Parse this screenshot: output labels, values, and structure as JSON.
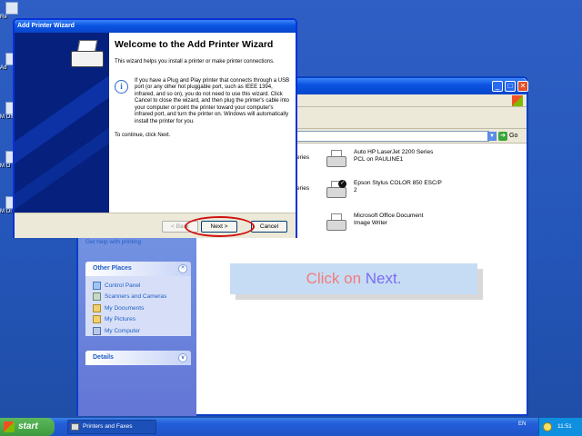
{
  "desktop": {
    "icons": [
      {
        "label": "Re",
        "icon": "recycle-bin-icon"
      },
      {
        "label": "Ad",
        "icon": "desktop-shortcut-icon"
      },
      {
        "label": "M Off",
        "icon": "desktop-shortcut-icon"
      },
      {
        "label": "M O",
        "icon": "desktop-shortcut-icon"
      },
      {
        "label": "M Ol",
        "icon": "desktop-shortcut-icon"
      }
    ]
  },
  "wizard": {
    "title": "Add Printer Wizard",
    "heading": "Welcome to the Add Printer Wizard",
    "intro": "This wizard helps you install a printer or make printer connections.",
    "info": "If you have a Plug and Play printer that connects through a USB port (or any other hot pluggable port, such as IEEE 1394, infrared, and so on), you do not need to use this wizard. Click Cancel to close the wizard, and then plug the printer's cable into your computer or point the printer toward your computer's infrared port, and turn the printer on. Windows will automatically install the printer for you.",
    "continue": "To continue, click Next.",
    "back_label": "< Back",
    "next_label": "Next >",
    "cancel_label": "Cancel"
  },
  "explorer": {
    "go_label": "Go",
    "printers": [
      {
        "name": "Auto HP LaserJet 2200 Series PCL on PAULINE1",
        "left_fragment": "eries",
        "default": false
      },
      {
        "name": "Epson Stylus COLOR 850 ESC/P 2",
        "left_fragment": "eries",
        "default": true
      },
      {
        "name": "Microsoft Office Document Image Writer",
        "left_fragment": "",
        "default": false
      }
    ],
    "help_link": "Get help with printing",
    "other_places": {
      "title": "Other Places",
      "links": [
        "Control Panel",
        "Scanners and Cameras",
        "My Documents",
        "My Pictures",
        "My Computer"
      ]
    },
    "details": {
      "title": "Details"
    }
  },
  "hint": {
    "part1": "Click on ",
    "part2": "Next."
  },
  "taskbar": {
    "start_label": "start",
    "task": "Printers and Faxes",
    "language": "EN",
    "clock": "11:51"
  }
}
